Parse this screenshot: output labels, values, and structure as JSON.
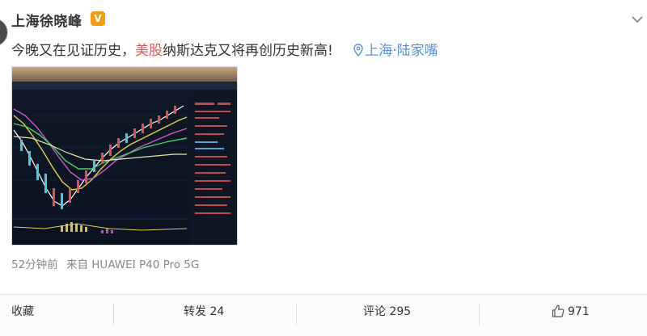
{
  "user": {
    "name": "上海徐晓峰",
    "badge": "V"
  },
  "post": {
    "text_before": "今晚又在见证历史，",
    "highlight": "美股",
    "text_after": "纳斯达克又将再创历史新高!",
    "location": "上海·陆家嘴"
  },
  "meta": {
    "time": "52分钟前",
    "source_prefix": "来自",
    "device": "HUAWEI P40 Pro 5G"
  },
  "actions": {
    "favorite": "收藏",
    "repost": "转发 24",
    "comment": "评论 295",
    "like": "971"
  },
  "icons": {
    "location": "map-pin-icon",
    "like": "thumbs-up-icon",
    "more": "chevron-down-icon",
    "verified": "verified-badge-icon"
  },
  "colors": {
    "highlight": "#e05a5a",
    "link": "#5b8ed6",
    "badge": "#f39c12"
  }
}
